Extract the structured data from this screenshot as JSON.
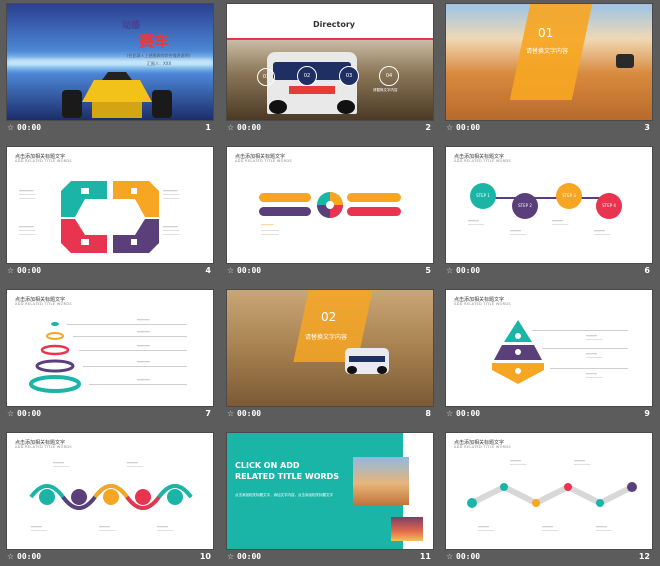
{
  "slides": [
    {
      "number": "1",
      "time": "00:00",
      "title_a": "动感",
      "title_b": "赛车",
      "subtitle": "(在此录入上述图表的综合描述说明)",
      "author": "汇报人：XXX"
    },
    {
      "number": "2",
      "time": "00:00",
      "brand": "Directory",
      "items": [
        "01",
        "02",
        "03",
        "04"
      ],
      "caption": "请替换文字内容"
    },
    {
      "number": "3",
      "time": "00:00",
      "section": "01",
      "caption": "请替换文字内容"
    },
    {
      "number": "4",
      "time": "00:00",
      "header": "点击添加相关标题文字",
      "header_en": "ADD RELATED TITLE WORDS"
    },
    {
      "number": "5",
      "time": "00:00",
      "header": "点击添加相关标题文字",
      "header_en": "ADD RELATED TITLE WORDS"
    },
    {
      "number": "6",
      "time": "00:00",
      "header": "点击添加相关标题文字",
      "header_en": "ADD RELATED TITLE WORDS",
      "steps": [
        "STEP 1",
        "STEP 2",
        "STEP 3",
        "STEP 4"
      ]
    },
    {
      "number": "7",
      "time": "00:00",
      "header": "点击添加相关标题文字",
      "header_en": "ADD RELATED TITLE WORDS"
    },
    {
      "number": "8",
      "time": "00:00",
      "section": "02",
      "caption": "请替换文字内容"
    },
    {
      "number": "9",
      "time": "00:00",
      "header": "点击添加相关标题文字",
      "header_en": "ADD RELATED TITLE WORDS"
    },
    {
      "number": "10",
      "time": "00:00",
      "header": "点击添加相关标题文字",
      "header_en": "ADD RELATED TITLE WORDS"
    },
    {
      "number": "11",
      "time": "00:00",
      "big_line1": "CLICK ON ADD",
      "big_line2": "RELATED TITLE WORDS",
      "body": "点击添加相关标题文字，添加文字内容，点击添加相关标题文字"
    },
    {
      "number": "12",
      "time": "00:00",
      "header": "点击添加相关标题文字",
      "header_en": "ADD RELATED TITLE WORDS"
    }
  ],
  "colors": {
    "teal": "#1bb5a8",
    "orange": "#f6a623",
    "purple": "#5b3f7a",
    "red": "#e8344e",
    "bg": "#5c5c5c"
  },
  "icons": {
    "star": "star-icon"
  }
}
